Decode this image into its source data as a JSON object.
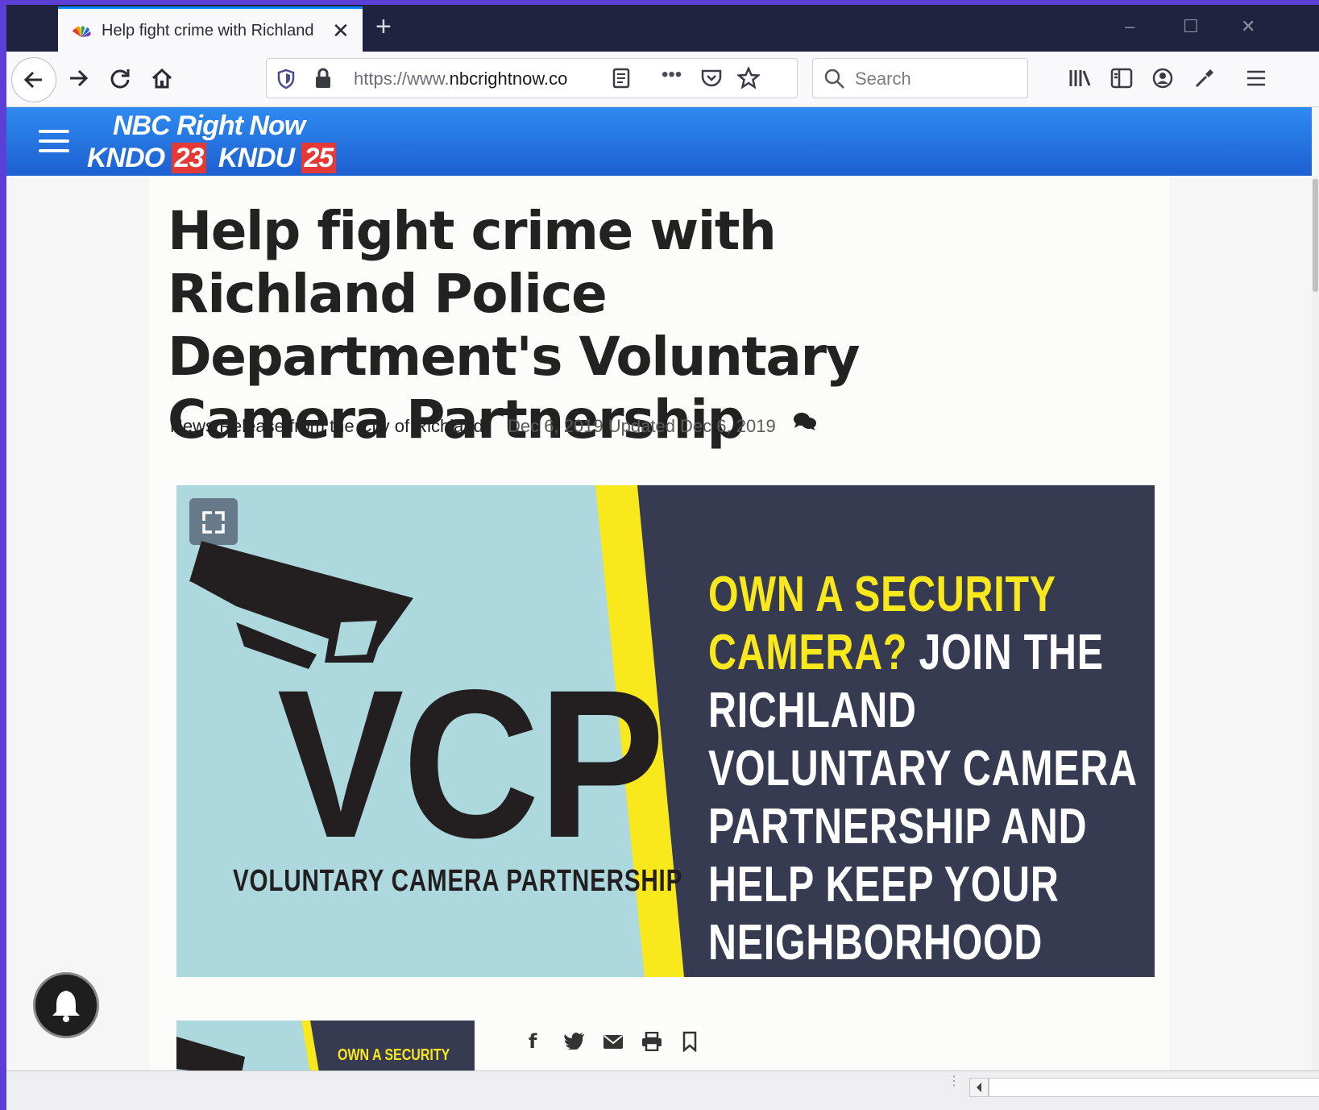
{
  "browser": {
    "tab_title": "Help fight crime with Richland",
    "new_tab_symbol": "+",
    "close_tab_symbol": "✕",
    "url_prefix": "https://www.",
    "url_domain": "nbcrightnow.co",
    "search_placeholder": "Search",
    "window_controls": [
      "–",
      "☐",
      "✕"
    ]
  },
  "site": {
    "logo_line1": "NBC Right Now",
    "logo_line2_a": "KNDO",
    "logo_line2_num_a": "23",
    "logo_line2_b": "KNDU",
    "logo_line2_num_b": "25",
    "brand_color": "#1d5fd1"
  },
  "article": {
    "headline": "Help fight crime with Richland Police Department's Voluntary Camera Partnership",
    "byline": "News Release from the City of Richland",
    "dates": "Dec 6, 2019 Updated Dec 6, 2019"
  },
  "hero": {
    "acronym": "VCP",
    "subtitle": "VOLUNTARY CAMERA PARTNERSHIP",
    "slogan_yellow": "OWN A SECURITY CAMERA?",
    "slogan_white": "JOIN THE RICHLAND VOLUNTARY CAMERA PARTNERSHIP AND HELP KEEP YOUR NEIGHBORHOOD SAFE.",
    "thumb_text": "OWN A SECURITY",
    "accent_yellow": "#f9e81b",
    "navy": "#363b52",
    "light_blue": "#add9de"
  },
  "share": {
    "icons": [
      "facebook-icon",
      "twitter-icon",
      "email-icon",
      "print-icon",
      "bookmark-icon"
    ],
    "facebook": "f",
    "twitter": "🐦",
    "email": "✉",
    "print": "🖶",
    "bookmark": "🔖"
  }
}
